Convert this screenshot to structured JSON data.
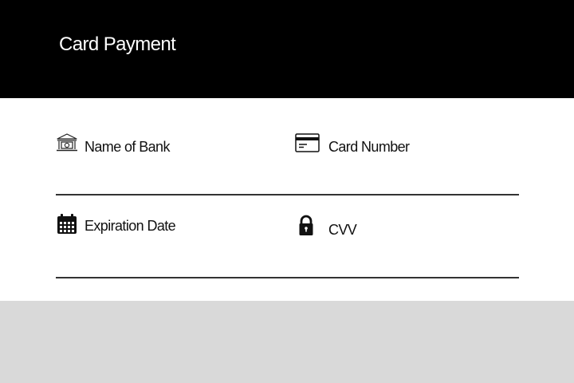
{
  "header": {
    "title": "Card Payment"
  },
  "form": {
    "bank_name": {
      "label": "Name of Bank",
      "icon": "bank-icon"
    },
    "card_number": {
      "label": "Card Number",
      "icon": "credit-card-icon"
    },
    "expiration_date": {
      "label": "Expiration Date",
      "icon": "calendar-icon"
    },
    "cvv": {
      "label": "CVV",
      "icon": "lock-icon"
    }
  },
  "colors": {
    "header_bg": "#000000",
    "header_text": "#ffffff",
    "form_bg": "#ffffff",
    "page_bg": "#d9d9d9",
    "divider": "#333333"
  }
}
